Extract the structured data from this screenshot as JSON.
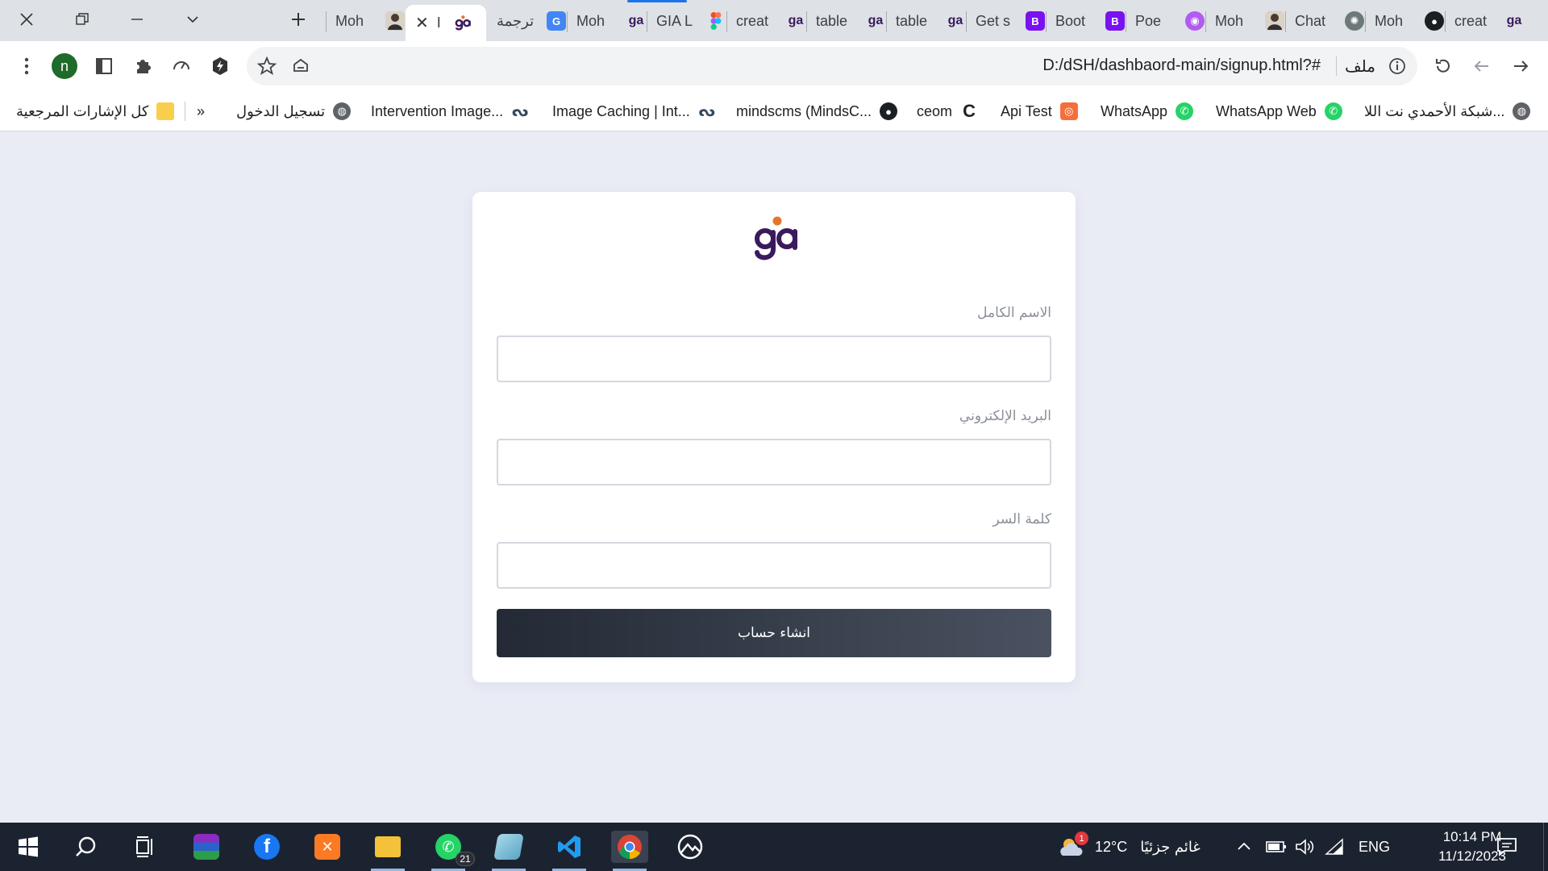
{
  "browser": {
    "tabs": [
      {
        "label": "Moh",
        "favicon": "avatar-icon"
      },
      {
        "label": "I",
        "favicon": "gia-logo-icon",
        "active": true
      },
      {
        "label": "ترجمة",
        "favicon": "google-translate-icon"
      },
      {
        "label": "Moh",
        "favicon": "gia-logo-icon"
      },
      {
        "label": "GIA L",
        "favicon": "figma-icon"
      },
      {
        "label": "creat",
        "favicon": "gia-logo-icon"
      },
      {
        "label": "table",
        "favicon": "gia-logo-icon"
      },
      {
        "label": "table",
        "favicon": "gia-logo-icon"
      },
      {
        "label": "Get s",
        "favicon": "bootstrap-icon"
      },
      {
        "label": "Boot",
        "favicon": "bootstrap-icon"
      },
      {
        "label": "Poe",
        "favicon": "poe-icon"
      },
      {
        "label": "Moh",
        "favicon": "avatar-icon"
      },
      {
        "label": "Chat",
        "favicon": "chatgpt-icon"
      },
      {
        "label": "Moh",
        "favicon": "github-icon"
      },
      {
        "label": "creat",
        "favicon": "gia-logo-icon"
      }
    ],
    "profile_initial": "n",
    "url": "D:/dSH/dashbaord-main/signup.html?#",
    "url_scheme_label": "ملف"
  },
  "bookmarks": {
    "all_bookmarks": "كل الإشارات المرجعية",
    "overflow": "»",
    "items": [
      {
        "label": "تسجيل الدخول",
        "icon": "globe-icon"
      },
      {
        "label": "Intervention Image...",
        "icon": "intervention-icon"
      },
      {
        "label": "Image Caching | Int...",
        "icon": "intervention-icon"
      },
      {
        "label": "mindscms (MindsC...",
        "icon": "github-icon"
      },
      {
        "label": "ceom",
        "icon": "c-logo-icon"
      },
      {
        "label": "Api Test",
        "icon": "api-test-icon"
      },
      {
        "label": "WhatsApp",
        "icon": "whatsapp-icon"
      },
      {
        "label": "WhatsApp Web",
        "icon": "whatsapp-icon"
      },
      {
        "label": "شبكة الأحمدي نت اللا...",
        "icon": "globe-icon"
      }
    ]
  },
  "signup": {
    "logo_text": "ga",
    "fullname_label": "الاسم الكامل",
    "fullname_value": "",
    "email_label": "البريد الإلكتروني",
    "email_value": "",
    "password_label": "كلمة السر",
    "password_value": "",
    "submit_label": "انشاء حساب"
  },
  "taskbar": {
    "whatsapp_badge": "21",
    "weather_badge": "1",
    "temperature": "12°C",
    "weather_text": "غائم جزئيًا",
    "language": "ENG",
    "time": "10:14 PM",
    "date": "11/12/2023"
  },
  "colors": {
    "page_background": "#e9ecf5",
    "button_gradient_start": "#232a35",
    "button_gradient_end": "#4a5261",
    "logo_primary": "#3a1a5c",
    "logo_accent": "#e8742c"
  }
}
